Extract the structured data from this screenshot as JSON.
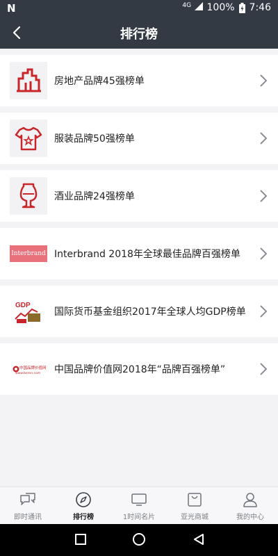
{
  "status_bar": {
    "carrier_glyph": "N",
    "network": "4G",
    "battery": "100%",
    "time": "7:46"
  },
  "header": {
    "title": "排行榜"
  },
  "rankings": [
    {
      "label": "房地产品牌45强榜单",
      "icon": "building-icon"
    },
    {
      "label": "服装品牌50强榜单",
      "icon": "tshirt-icon"
    },
    {
      "label": "酒业品牌24强榜单",
      "icon": "wine-glass-icon"
    },
    {
      "label": "Interbrand 2018年全球最佳品牌百强榜单",
      "icon": "interbrand-logo",
      "logo_text": "Interbrand"
    },
    {
      "label": "国际货币基金组织2017年全球人均GDP榜单",
      "icon": "gdp-logo",
      "logo_text": "GDP"
    },
    {
      "label": "中国品牌价值网2018年“品牌百强榜单”",
      "icon": "chinabrand-logo",
      "logo_text": "中国品牌价值网",
      "logo_subtext": "www.beren.com"
    }
  ],
  "bottom_nav": [
    {
      "label": "即时通讯",
      "icon": "chat-icon",
      "active": false
    },
    {
      "label": "排行榜",
      "icon": "compass-icon",
      "active": true
    },
    {
      "label": "1时间名片",
      "icon": "tv-icon",
      "active": false
    },
    {
      "label": "亚光商城",
      "icon": "shopping-bag-icon",
      "active": false
    },
    {
      "label": "我的中心",
      "icon": "person-icon",
      "active": false
    }
  ],
  "colors": {
    "header_bg": "#333a44",
    "brand_red": "#c9262b",
    "interbrand_bg": "#e8717b"
  }
}
